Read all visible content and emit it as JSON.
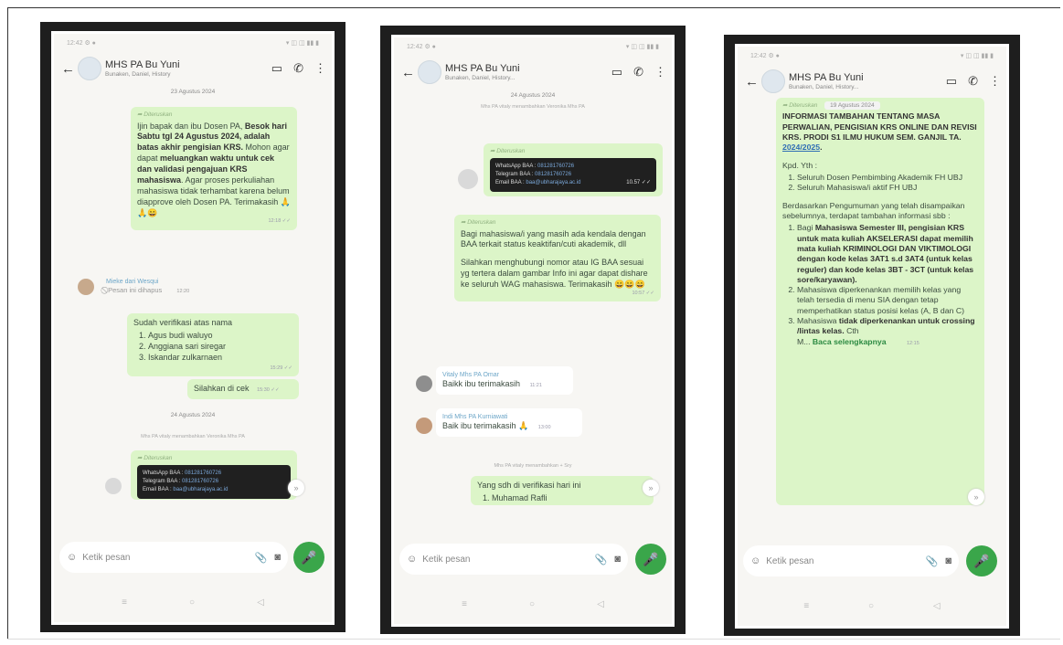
{
  "status_bar": {
    "left": "12:42 ⚙ ●",
    "right": "▾ ◫ ◫ ▮▮ ▮"
  },
  "header": {
    "title": "MHS PA Bu Yuni",
    "subtitle_1": "Bunaken, Daniel, History",
    "subtitle_2": "Bunaken, Daniel, History...",
    "subtitle_3": "Bunaken, Daniel, History..."
  },
  "input": {
    "placeholder": "Ketik pesan"
  },
  "nav": {
    "menu": "≡",
    "home": "○",
    "back": "◁"
  },
  "phone1": {
    "date_1": "23 Agustus 2024",
    "forwarded": "Diteruskan",
    "msg1": {
      "t1": "Ijin bapak dan ibu Dosen PA, ",
      "b1": "Besok hari Sabtu tgl 24 Agustus 2024, adalah batas akhir pengisian KRS.",
      "t2": " Mohon agar dapat ",
      "b2": "meluangkan waktu untuk cek dan validasi pengajuan KRS mahasiswa",
      "t3": ". Agar proses perkuliahan mahasiswa tidak terhambat karena belum diapprove oleh Dosen PA. Terimakasih 🙏🙏😄",
      "time": "12:18 ✓✓"
    },
    "sender_deleted": "Mieke dari Wesqui",
    "deleted_msg": "Pesan ini dihapus",
    "deleted_time": "12:20",
    "verif": {
      "intro": "Sudah verifikasi atas nama",
      "names": [
        "Agus budi waluyo",
        "Anggiana sari siregar",
        "Iskandar zulkarnaen"
      ],
      "time": "15:29 ✓✓"
    },
    "cek": {
      "text": "Silahkan di cek",
      "time": "15:30 ✓✓"
    },
    "date_2": "24 Agustus 2024",
    "sys": "Mhs PA vitaly menambahkan Veronika Mhs PA",
    "card": {
      "l1a": "WhatsApp BAA : ",
      "l1b": "081281760726",
      "l2a": "Telegram BAA : ",
      "l2b": "081281760726",
      "l3a": "Email BAA : ",
      "l3b": "baa@ubharajaya.ac.id",
      "time": "10:57"
    }
  },
  "phone2": {
    "date": "24 Agustus 2024",
    "sys_1": "Mhs PA vitaly menambahkan Veronika Mhs PA",
    "forwarded": "Diteruskan",
    "card": {
      "l1a": "WhatsApp BAA : ",
      "l1b": "081281760726",
      "l2a": "Telegram BAA : ",
      "l2b": "081281760726",
      "l3a": "Email BAA : ",
      "l3b": "baa@ubharajaya.ac.id",
      "time": "10.57 ✓✓"
    },
    "msg": {
      "p1": "Bagi mahasiswa/i yang masih ada kendala dengan BAA terkait status keaktifan/cuti akademik, dll",
      "p2": "Silahkan menghubungi nomor atau IG BAA sesuai yg tertera dalam gambar Info ini agar dapat dishare ke seluruh WAG mahasiswa. Terimakasih 😄😄😄",
      "time": "10:57 ✓✓"
    },
    "reply1": {
      "sender": "Vitaly Mhs PA Omar",
      "text": "Baikk ibu terimakasih",
      "time": "11:21"
    },
    "reply2": {
      "sender": "Indi Mhs PA Kurniawati",
      "text": "Baik ibu terimakasih 🙏",
      "time": "13:00"
    },
    "sys_2": "Mhs PA vitaly menambahkan + Sry",
    "last": {
      "intro": "Yang sdh di verifikasi hari ini",
      "item1": "Muhamad Rafli"
    }
  },
  "phone3": {
    "date": "19 Agustus 2024",
    "forwarded": "Diteruskan",
    "title": "INFORMASI TAMBAHAN TENTANG MASA PERWALIAN, PENGISIAN KRS ONLINE DAN REVISI KRS. PRODI S1 ILMU HUKUM SEM. GANJIL TA. ",
    "title_link": "2024/2025",
    "title_end": ".",
    "kpd": "Kpd. Yth :",
    "recipients": [
      "Seluruh Dosen Pembimbing Akademik FH UBJ",
      "Seluruh Mahasiswa/i aktif FH UBJ"
    ],
    "intro": "Berdasarkan Pengumuman yang telah disampaikan sebelumnya, terdapat tambahan informasi sbb :",
    "item1_pre": "Bagi ",
    "item1_bold": "Mahasiswa Semester III, pengisian KRS untuk mata kuliah AKSELERASI dapat memilih mata kuliah KRIMINOLOGI DAN VIKTIMOLOGI dengan kode kelas 3AT1 s.d 3AT4 (untuk kelas reguler) dan kode kelas 3BT - 3CT (untuk kelas sore/karyawan).",
    "item2": "Mahasiswa diperkenankan memilih kelas yang telah tersedia di menu SIA dengan tetap memperhatikan status posisi kelas (A, B dan C)",
    "item3_pre": "Mahasiswa ",
    "item3_bold": "tidak diperkenankan untuk crossing /lintas kelas.",
    "item3_post": " Cth",
    "more_prefix": "M... ",
    "more_link": "Baca selengkapnya",
    "time": "12:15"
  }
}
